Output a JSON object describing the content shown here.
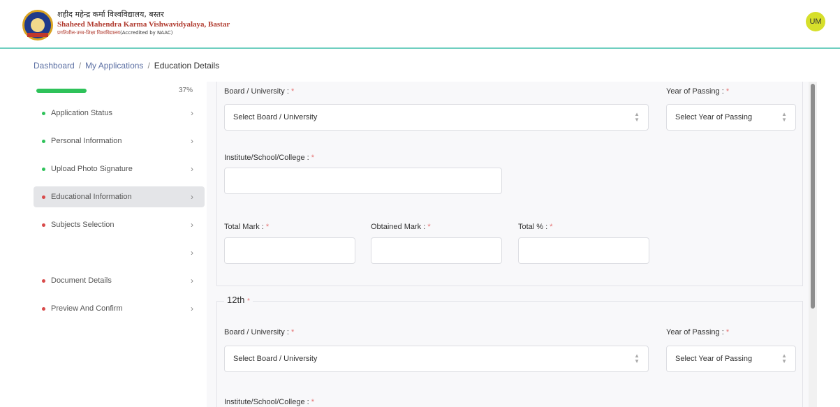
{
  "header": {
    "university_hindi": "शहीद महेन्द्र कर्मा विश्वविद्यालय, बस्तर",
    "university_english": "Shaheed Mahendra Karma Vishwavidyalaya, Bastar",
    "tagline": "प्रगतिशील-उच्च-शिक्षा विश्वविद्यालय",
    "accreditation": "(Accredited by NAAC)",
    "avatar_initials": "UM"
  },
  "breadcrumb": {
    "items": [
      "Dashboard",
      "My Applications"
    ],
    "separator": "/",
    "current": "Education Details"
  },
  "sidebar": {
    "progress_percent": 37,
    "progress_label": "37%",
    "items": [
      {
        "label": "Application Status",
        "status": "complete"
      },
      {
        "label": "Personal Information",
        "status": "complete"
      },
      {
        "label": "Upload Photo Signature",
        "status": "complete"
      },
      {
        "label": "Educational Information",
        "status": "incomplete",
        "active": true
      },
      {
        "label": "Subjects Selection",
        "status": "incomplete"
      },
      {
        "label": "",
        "status": "none"
      },
      {
        "label": "Document Details",
        "status": "incomplete"
      },
      {
        "label": "Preview And Confirm",
        "status": "incomplete"
      }
    ],
    "chevron": "›"
  },
  "form": {
    "section_10th": {
      "board_label": "Board / University :",
      "board_placeholder": "Select Board / University",
      "year_label": "Year of Passing :",
      "year_placeholder": "Select Year of Passing",
      "institute_label": "Institute/School/College :",
      "total_mark_label": "Total Mark :",
      "obtained_mark_label": "Obtained Mark :",
      "total_percent_label": "Total % :"
    },
    "section_12th": {
      "legend": "12th",
      "board_label": "Board / University :",
      "board_placeholder": "Select Board / University",
      "year_label": "Year of Passing :",
      "year_placeholder": "Select Year of Passing",
      "institute_label": "Institute/School/College :"
    },
    "required_mark": "*"
  },
  "colors": {
    "accent_teal": "#6fcfc0",
    "progress_green": "#2ec25a",
    "status_red": "#d84a4a",
    "avatar_bg": "#d6df2b"
  }
}
